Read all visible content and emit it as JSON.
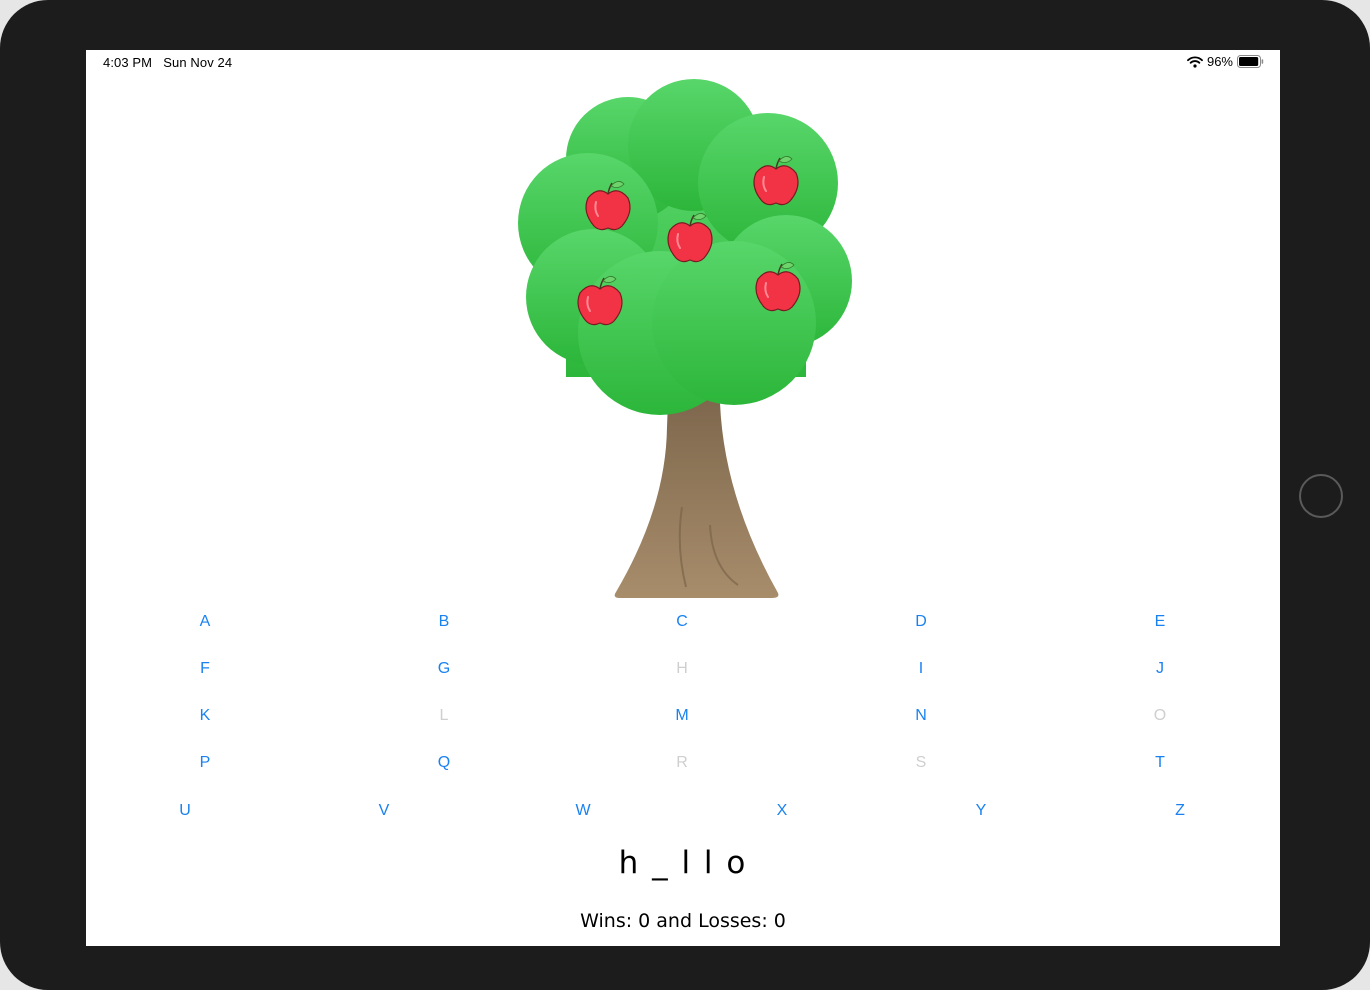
{
  "status_bar": {
    "time": "4:03 PM",
    "date": "Sun Nov 24",
    "battery_percent": "96%",
    "battery_level": 0.96
  },
  "tree": {
    "image": "apple-tree",
    "apples_remaining": 5
  },
  "keyboard": {
    "rows": [
      [
        {
          "letter": "A",
          "enabled": true
        },
        {
          "letter": "B",
          "enabled": true
        },
        {
          "letter": "C",
          "enabled": true
        },
        {
          "letter": "D",
          "enabled": true
        },
        {
          "letter": "E",
          "enabled": true
        }
      ],
      [
        {
          "letter": "F",
          "enabled": true
        },
        {
          "letter": "G",
          "enabled": true
        },
        {
          "letter": "H",
          "enabled": false
        },
        {
          "letter": "I",
          "enabled": true
        },
        {
          "letter": "J",
          "enabled": true
        }
      ],
      [
        {
          "letter": "K",
          "enabled": true
        },
        {
          "letter": "L",
          "enabled": false
        },
        {
          "letter": "M",
          "enabled": true
        },
        {
          "letter": "N",
          "enabled": true
        },
        {
          "letter": "O",
          "enabled": false
        }
      ],
      [
        {
          "letter": "P",
          "enabled": true
        },
        {
          "letter": "Q",
          "enabled": true
        },
        {
          "letter": "R",
          "enabled": false
        },
        {
          "letter": "S",
          "enabled": false
        },
        {
          "letter": "T",
          "enabled": true
        }
      ],
      [
        {
          "letter": "U",
          "enabled": true
        },
        {
          "letter": "V",
          "enabled": true
        },
        {
          "letter": "W",
          "enabled": true
        },
        {
          "letter": "X",
          "enabled": true
        },
        {
          "letter": "Y",
          "enabled": true
        },
        {
          "letter": "Z",
          "enabled": true
        }
      ]
    ]
  },
  "game": {
    "word_display": "h_llo",
    "score_text": "Wins: 0 and Losses: 0"
  },
  "colors": {
    "accent": "#1a82f0",
    "disabled": "#cfcfcf",
    "foliage_top": "#58d66a",
    "foliage_bottom": "#2cb63a",
    "trunk_top": "#7b654b",
    "trunk_bottom": "#a88d6b",
    "apple": "#f23345"
  }
}
